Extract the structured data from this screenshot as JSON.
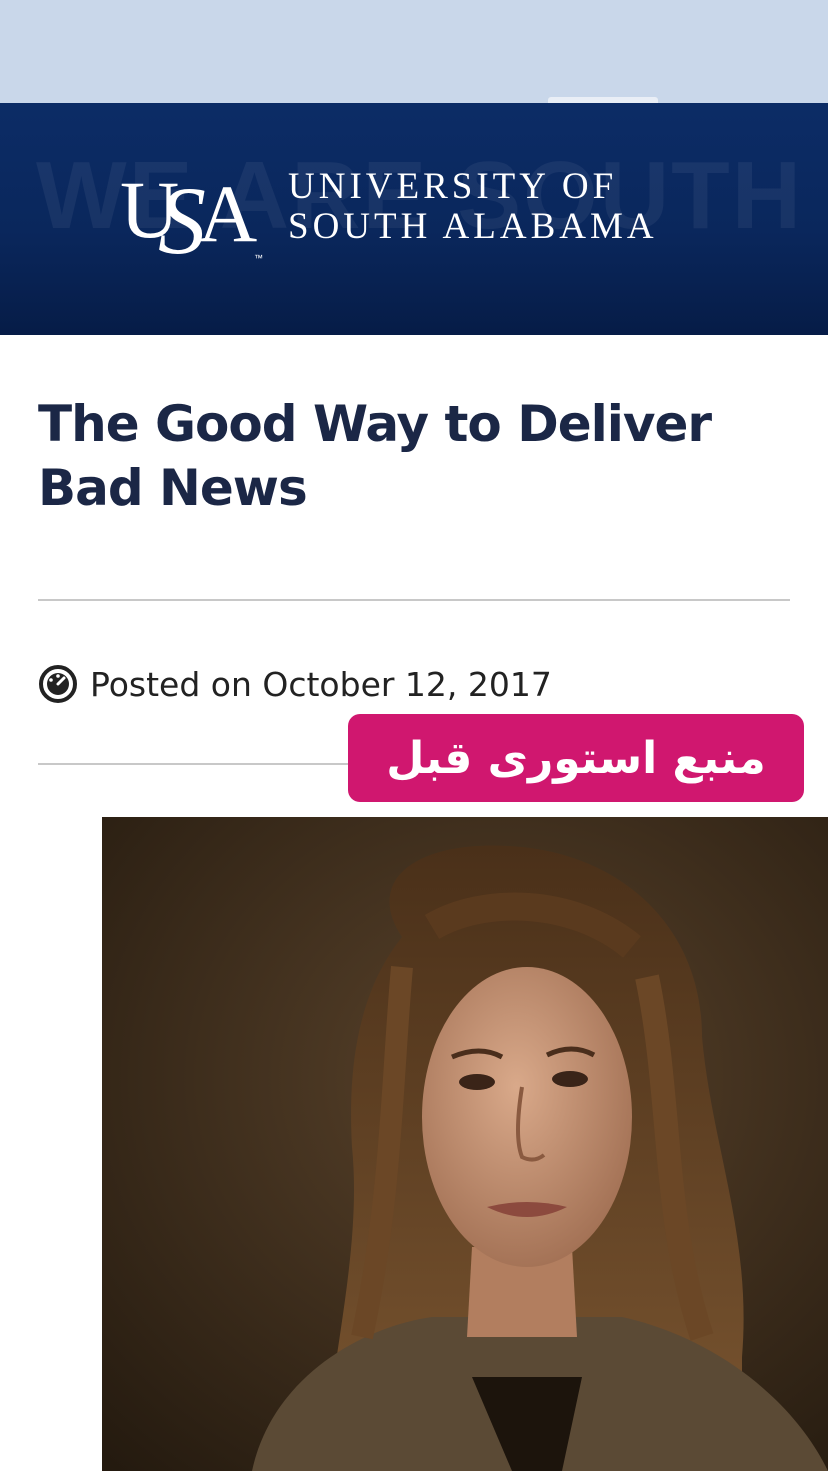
{
  "header": {
    "watermark": "WE ARE SOUTH",
    "logo_letters": "USA",
    "university_line1": "UNIVERSITY OF",
    "university_line2": "SOUTH ALABAMA",
    "background_color": "#0a275c"
  },
  "article": {
    "title": "The Good Way to Deliver Bad News",
    "posted": "Posted on October 12, 2017",
    "posted_icon": "clock-icon"
  },
  "overlay": {
    "badge_text": "منبع استوری قبل",
    "badge_color": "#d0176f"
  },
  "photo": {
    "subject": "portrait-photo"
  }
}
